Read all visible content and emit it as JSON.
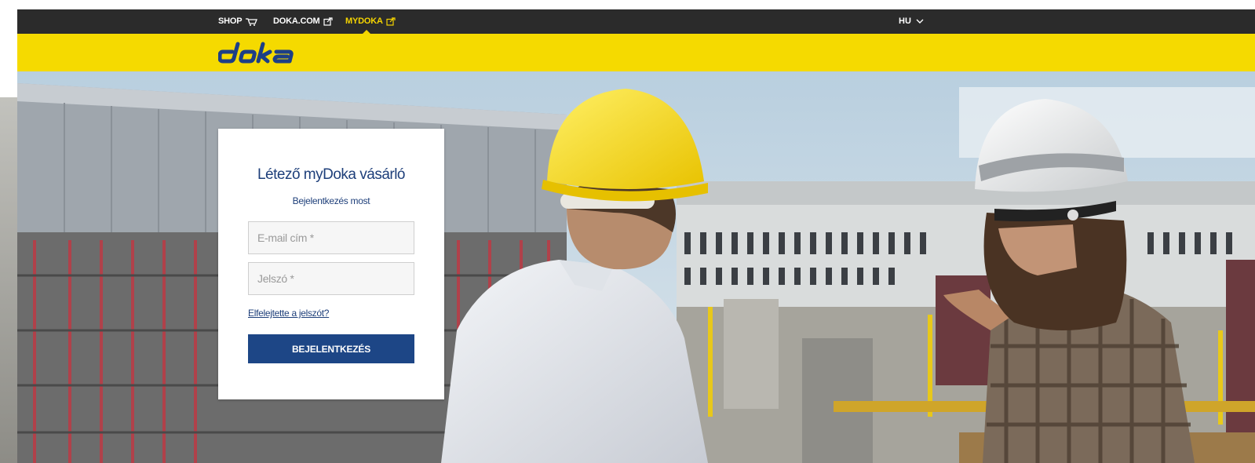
{
  "topnav": {
    "shop_label": "SHOP",
    "shop_icon": "cart-icon",
    "dokacom_label": "DOKA.COM",
    "mydoka_label": "MYDOKA",
    "external_icon": "external-link-icon",
    "language": "HU",
    "language_icon": "chevron-down-icon"
  },
  "brand": {
    "logo_text": "doka",
    "logo_color": "#1d3f86",
    "bar_color": "#f5da00"
  },
  "login": {
    "title": "Létező myDoka vásárló",
    "subtitle": "Bejelentkezés most",
    "email_placeholder": "E-mail cím *",
    "password_placeholder": "Jelszó *",
    "forgot_label": "Elfelejtette a jelszót?",
    "submit_label": "BEJELENTKEZÉS",
    "accent_color": "#1d4686"
  }
}
